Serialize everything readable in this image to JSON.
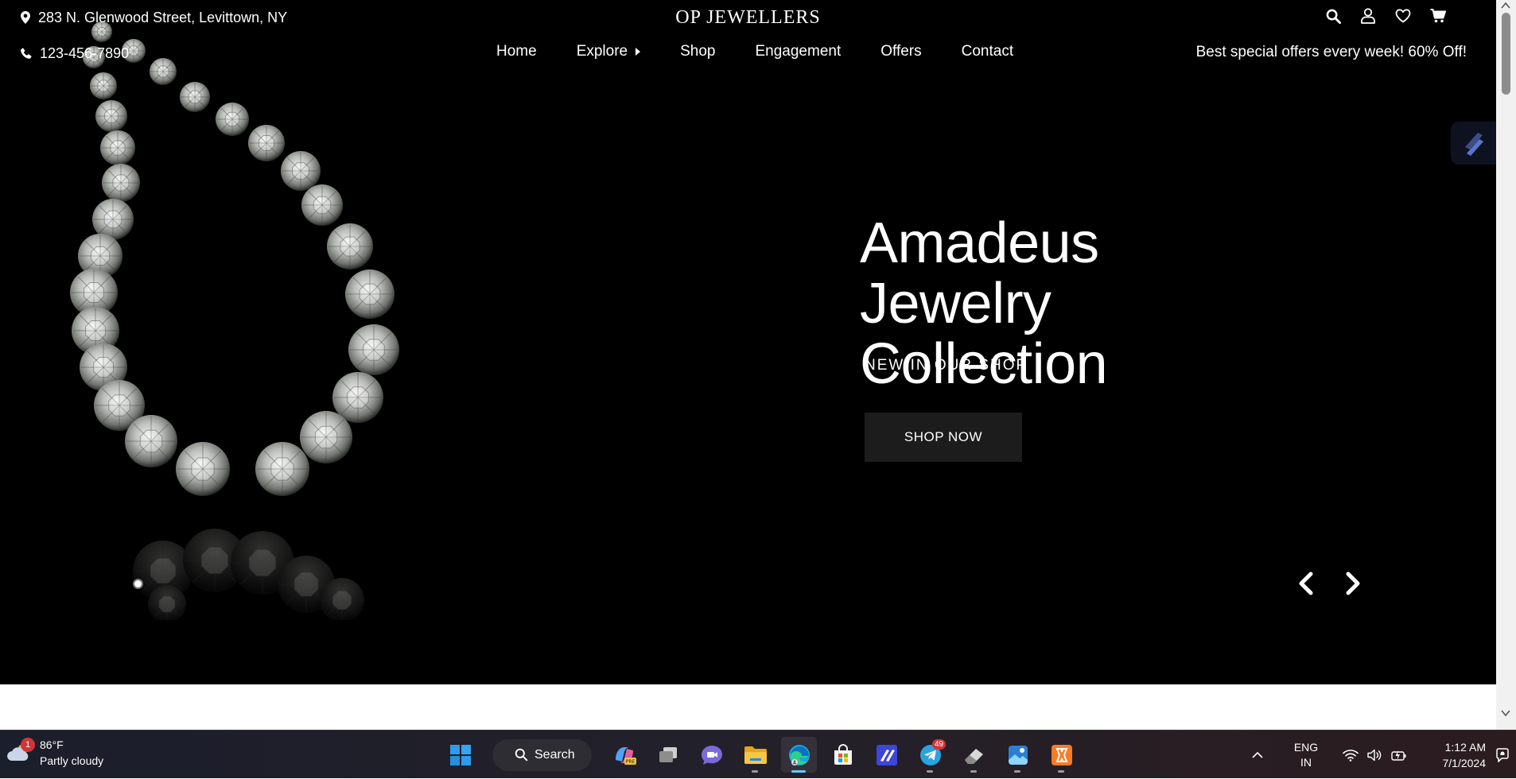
{
  "header": {
    "address": "283 N. Glenwood Street, Levittown, NY",
    "phone": "123-456-7890",
    "brand": "OP JEWELLERS",
    "promo": "Best special offers every week! 60% Off!"
  },
  "nav": {
    "home": "Home",
    "explore": "Explore",
    "shop": "Shop",
    "engagement": "Engagement",
    "offers": "Offers",
    "contact": "Contact"
  },
  "hero": {
    "title_line1": "Amadeus Jewelry",
    "title_line2": "Collection",
    "subtitle": "NEW IN OUR SHOP",
    "cta": "SHOP NOW"
  },
  "icons": {
    "header": [
      "search-icon",
      "user-icon",
      "heart-icon",
      "cart-icon"
    ],
    "hero": [
      "prev-arrow-icon",
      "next-arrow-icon",
      "slide-dot"
    ],
    "colors": {
      "hero_bg": "#000000",
      "cta_bg": "#1c1c1c",
      "text": "#ffffff",
      "scrollbar_thumb": "#8c8c8c"
    }
  },
  "taskbar": {
    "weather": {
      "temp": "86°F",
      "desc": "Partly cloudy",
      "badge": "1"
    },
    "search": "Search",
    "telegram_badge": "49",
    "lang_line1": "ENG",
    "lang_line2": "IN",
    "time": "1:12 AM",
    "date": "7/1/2024"
  }
}
